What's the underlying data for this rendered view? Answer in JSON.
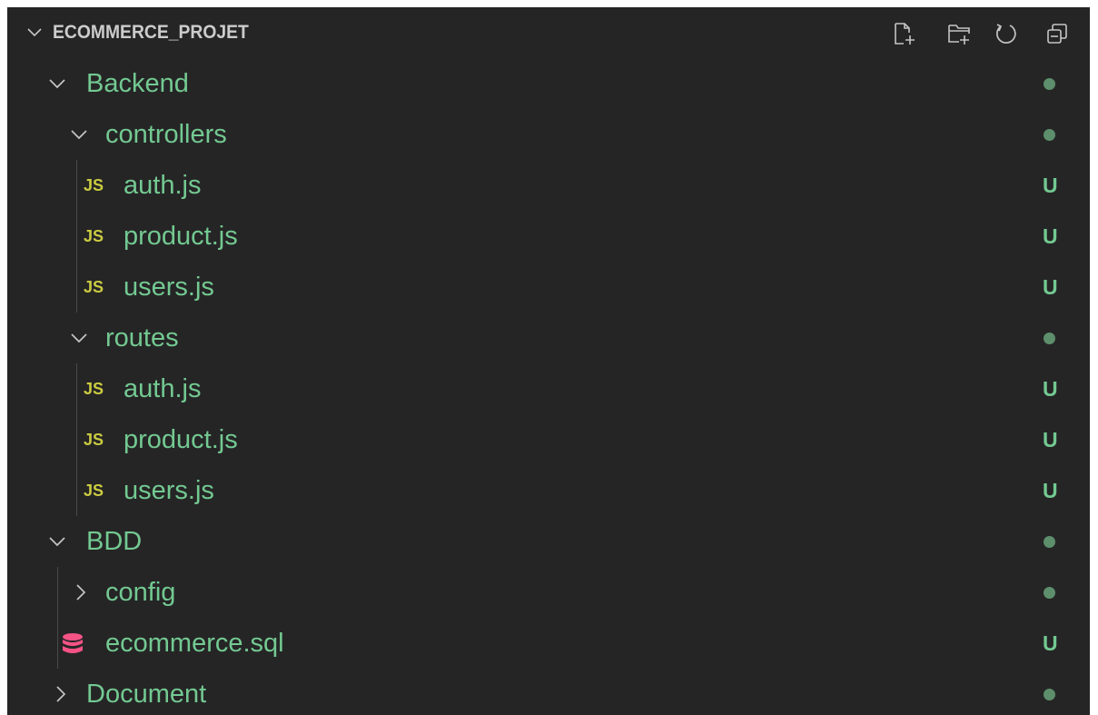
{
  "explorer": {
    "title": "ECOMMERCE_PROJET",
    "actions": [
      {
        "name": "new-file",
        "icon": "new-file-icon"
      },
      {
        "name": "new-folder",
        "icon": "new-folder-icon"
      },
      {
        "name": "refresh",
        "icon": "refresh-icon"
      },
      {
        "name": "collapse-all",
        "icon": "collapse-all-icon"
      }
    ]
  },
  "tree": [
    {
      "label": "Backend",
      "kind": "folder",
      "expanded": true,
      "status": "dot"
    },
    {
      "label": "controllers",
      "kind": "folder",
      "expanded": true,
      "status": "dot"
    },
    {
      "label": "auth.js",
      "kind": "js",
      "icon_text": "JS",
      "status": "U"
    },
    {
      "label": "product.js",
      "kind": "js",
      "icon_text": "JS",
      "status": "U"
    },
    {
      "label": "users.js",
      "kind": "js",
      "icon_text": "JS",
      "status": "U"
    },
    {
      "label": "routes",
      "kind": "folder",
      "expanded": true,
      "status": "dot"
    },
    {
      "label": "auth.js",
      "kind": "js",
      "icon_text": "JS",
      "status": "U"
    },
    {
      "label": "product.js",
      "kind": "js",
      "icon_text": "JS",
      "status": "U"
    },
    {
      "label": "users.js",
      "kind": "js",
      "icon_text": "JS",
      "status": "U"
    },
    {
      "label": "BDD",
      "kind": "folder",
      "expanded": true,
      "status": "dot"
    },
    {
      "label": "config",
      "kind": "folder",
      "expanded": false,
      "status": "dot"
    },
    {
      "label": "ecommerce.sql",
      "kind": "db",
      "status": "U"
    },
    {
      "label": "Document",
      "kind": "folder",
      "expanded": false,
      "status": "dot"
    }
  ],
  "colors": {
    "background": "#252526",
    "untracked_green": "#73c991",
    "js_yellow": "#cbcb41",
    "db_pink": "#f55385",
    "dot": "#5e8f6c"
  }
}
